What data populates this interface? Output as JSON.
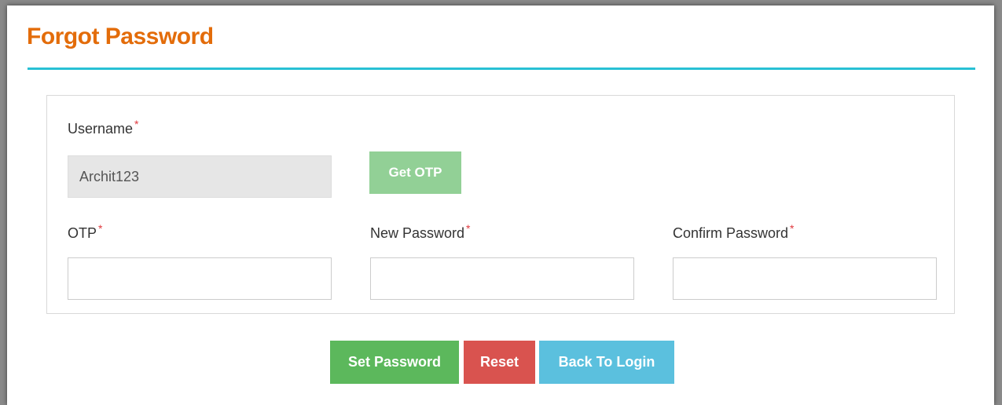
{
  "page": {
    "title": "Forgot Password"
  },
  "form": {
    "username": {
      "label": "Username",
      "required_mark": "*",
      "value": "Archit123"
    },
    "get_otp_label": "Get OTP",
    "otp": {
      "label": "OTP",
      "required_mark": "*",
      "value": ""
    },
    "new_password": {
      "label": "New Password",
      "required_mark": "*",
      "value": ""
    },
    "confirm_password": {
      "label": "Confirm Password",
      "required_mark": "*",
      "value": ""
    }
  },
  "actions": {
    "set_password_label": "Set Password",
    "reset_label": "Reset",
    "back_to_login_label": "Back To Login"
  },
  "colors": {
    "title": "#e36c0a",
    "rule": "#28c0d4",
    "required": "#e0393e",
    "get_otp": "#92d096",
    "set_password": "#5cb85c",
    "reset": "#d9534f",
    "back_to_login": "#5bc0de"
  }
}
